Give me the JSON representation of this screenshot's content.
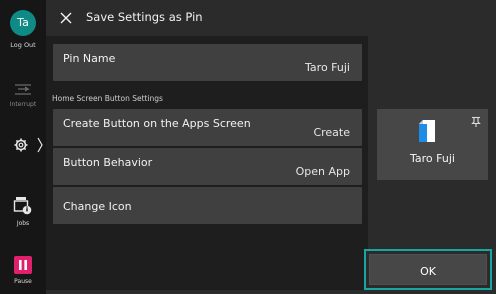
{
  "rail": {
    "avatar_initials": "Ta",
    "logout_label": "Log Out",
    "interrupt_label": "Interrupt",
    "jobs_label": "Jobs",
    "pause_label": "Pause"
  },
  "header": {
    "title": "Save Settings as Pin",
    "close_icon": "close-icon"
  },
  "form": {
    "pin_name": {
      "label": "Pin Name",
      "value": "Taro Fuji"
    },
    "section_label": "Home Screen Button Settings",
    "create_button": {
      "label": "Create Button on the Apps Screen",
      "value": "Create"
    },
    "button_behavior": {
      "label": "Button Behavior",
      "value": "Open App"
    },
    "change_icon": {
      "label": "Change Icon"
    }
  },
  "preview": {
    "name": "Taro Fuji",
    "pin_icon": "pin-icon",
    "app_icon": "document-icon"
  },
  "footer": {
    "ok_label": "OK"
  },
  "colors": {
    "accent": "#16a7a2",
    "pause": "#e0206c",
    "avatar": "#0f8a84"
  }
}
